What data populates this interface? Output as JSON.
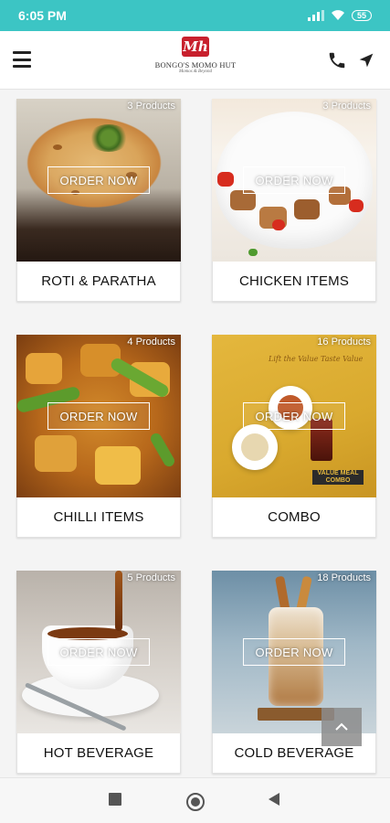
{
  "status_bar": {
    "time": "6:05 PM",
    "battery": "55"
  },
  "header": {
    "logo_mark": "Mh",
    "logo_name": "BONGO'S MOMO HUT",
    "logo_tagline": "Momos & Beyond"
  },
  "order_label": "ORDER NOW",
  "categories": [
    {
      "name": "ROTI & PARATHA",
      "count": "3 Products"
    },
    {
      "name": "CHICKEN ITEMS",
      "count": "3 Products"
    },
    {
      "name": "CHILLI ITEMS",
      "count": "4 Products"
    },
    {
      "name": "COMBO",
      "count": "16 Products",
      "promo": "VALUE MEAL COMBO",
      "script": "Lift the Value Taste Value"
    },
    {
      "name": "HOT BEVERAGE",
      "count": "5 Products"
    },
    {
      "name": "COLD BEVERAGE",
      "count": "18 Products"
    }
  ],
  "colors": {
    "status_bar": "#3cc5c4",
    "logo_red": "#c8202d",
    "background": "#f4f4f4"
  },
  "icons": [
    "menu-icon",
    "phone-icon",
    "navigation-arrow-icon",
    "chevron-up-icon",
    "recent-apps-icon",
    "home-icon",
    "back-icon",
    "wifi-icon",
    "signal-icon"
  ]
}
